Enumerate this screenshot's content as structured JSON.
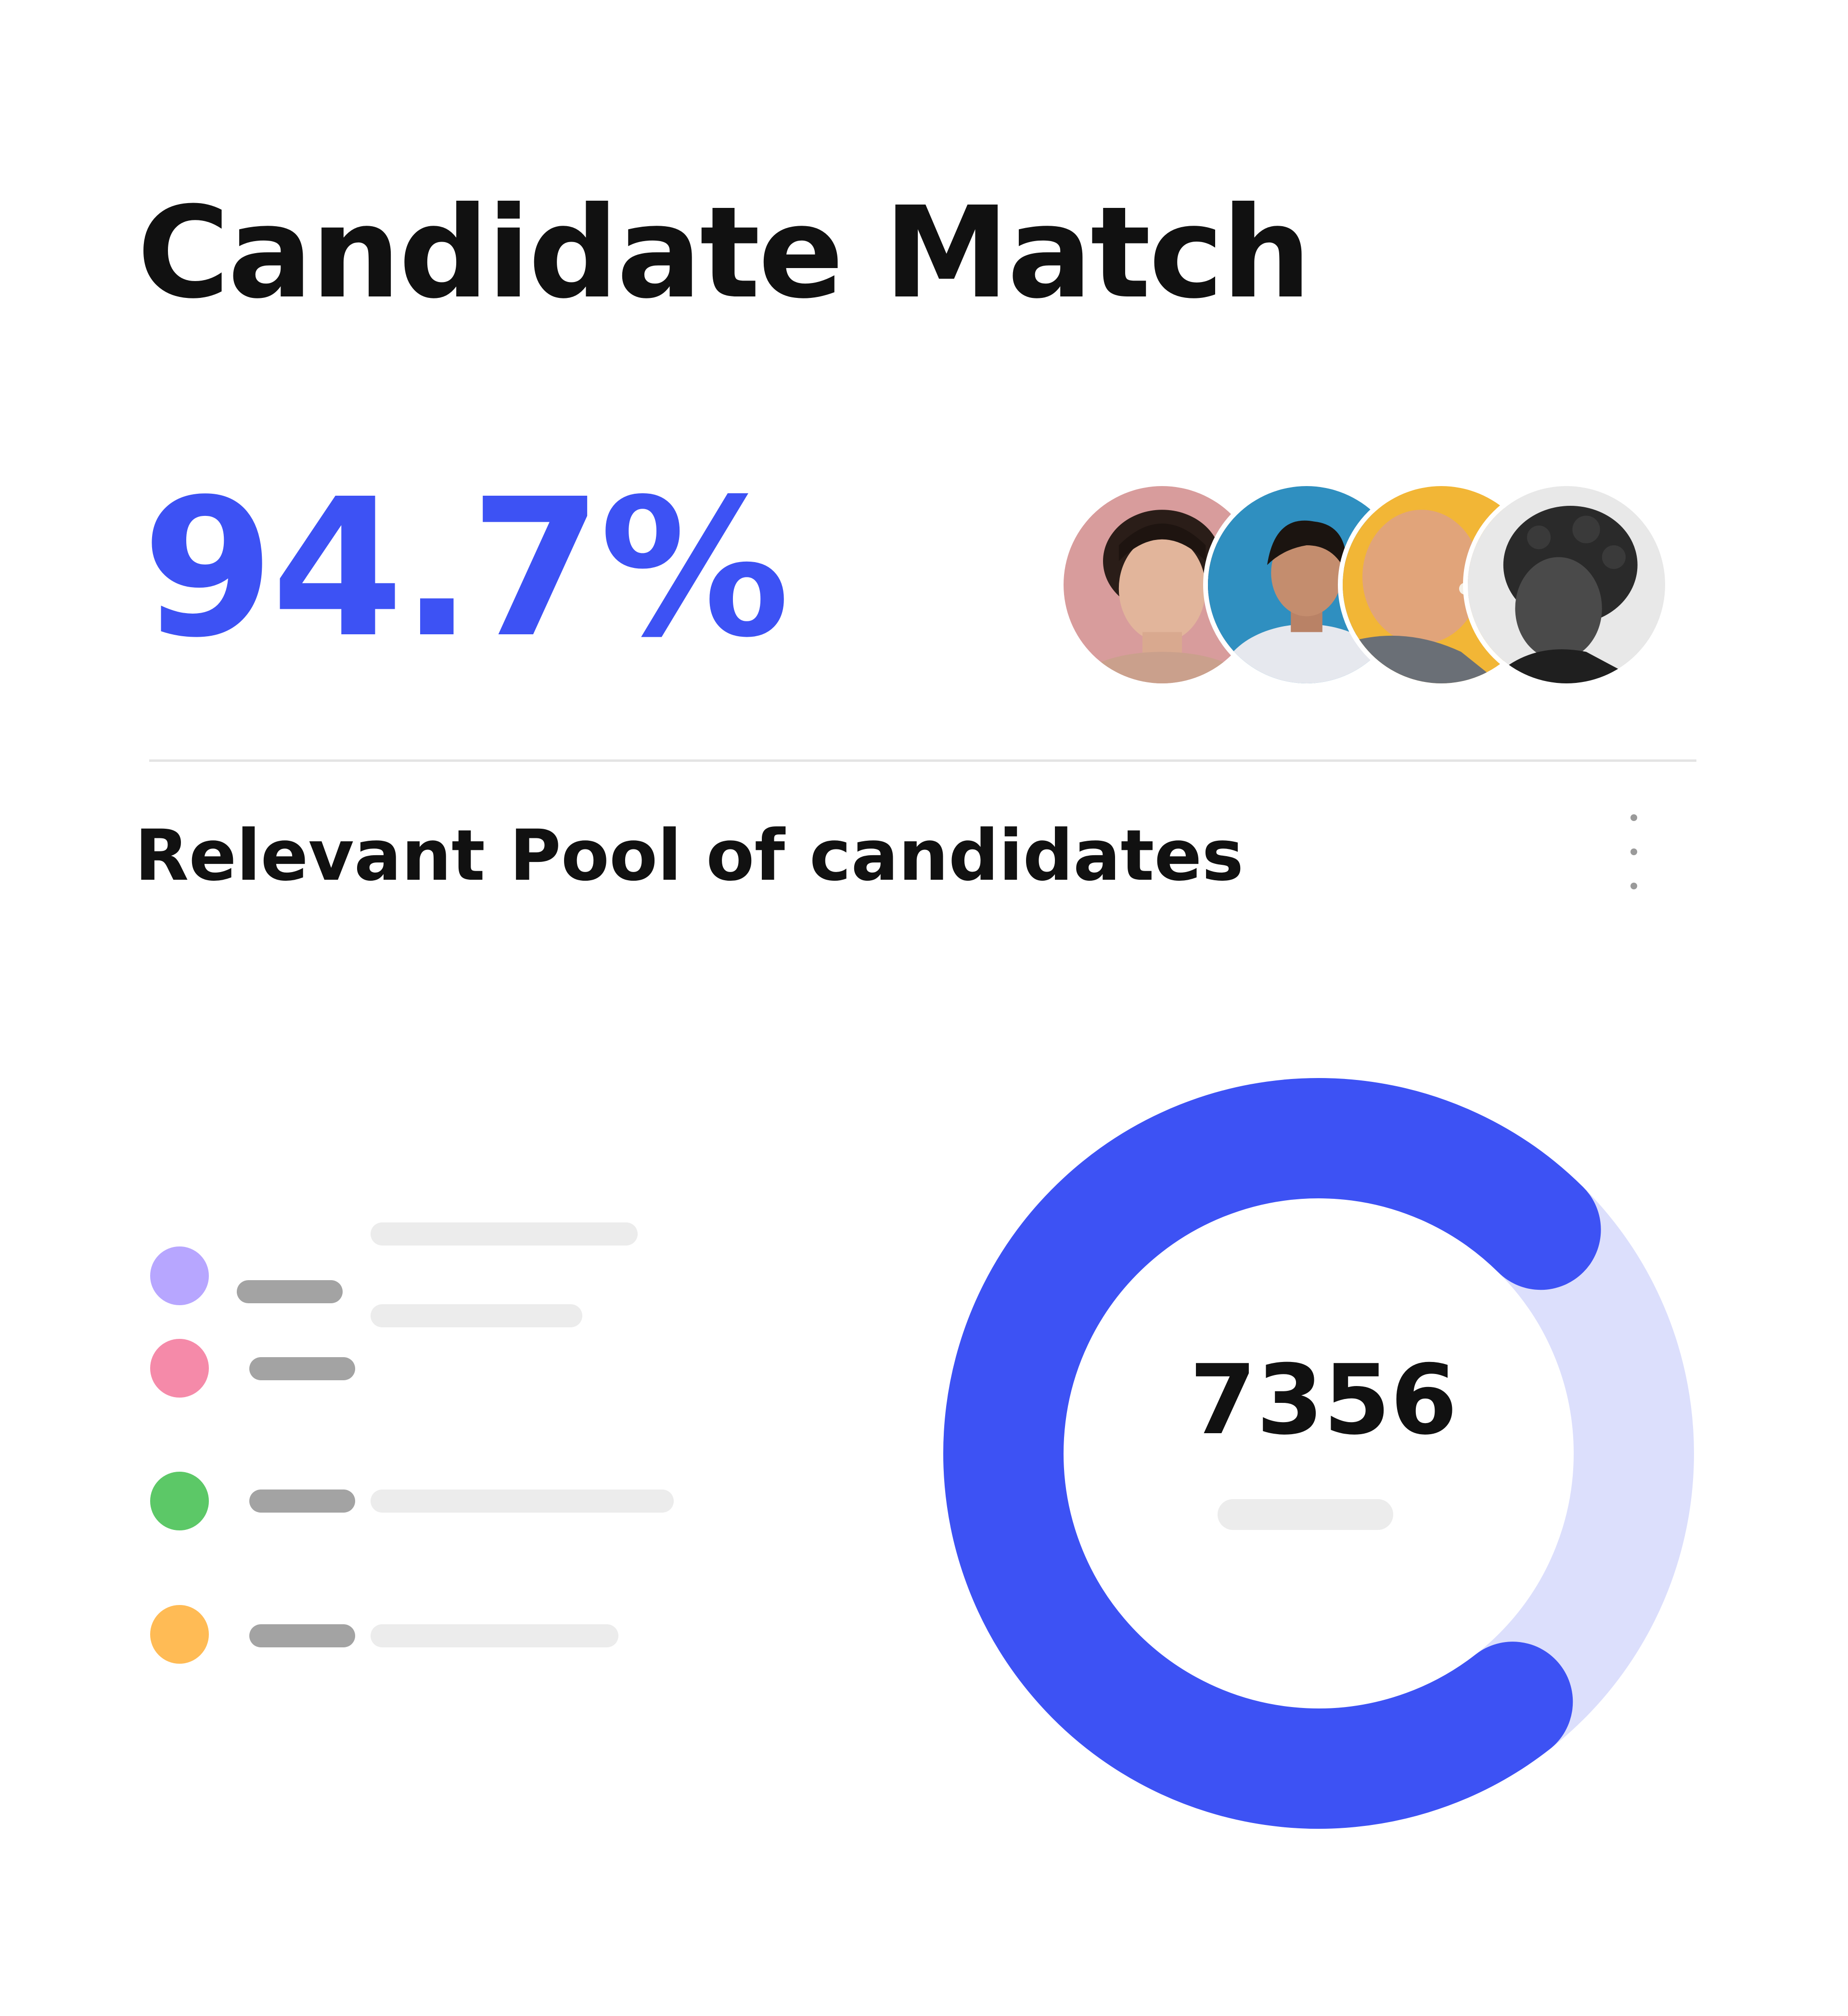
{
  "card": {
    "title": "Candidate Match",
    "match_value": "94.7%",
    "section_title": "Relevant Pool of candidates",
    "accent_color": "#3d52f4"
  },
  "avatars": [
    {
      "name": "avatar-1"
    },
    {
      "name": "avatar-2"
    },
    {
      "name": "avatar-3"
    },
    {
      "name": "avatar-4"
    }
  ],
  "menu": {
    "icon": "more-vertical-icon"
  },
  "legend": [
    {
      "color": "#b7a6ff"
    },
    {
      "color": "#f58aa9"
    },
    {
      "color": "#5cc867"
    },
    {
      "color": "#ffbb55"
    }
  ],
  "chart_data": {
    "type": "donut",
    "center_value": "7356",
    "highlighted_fraction": 0.73,
    "colors": {
      "highlight": "#3d52f4",
      "track": "#dcdffc"
    }
  }
}
